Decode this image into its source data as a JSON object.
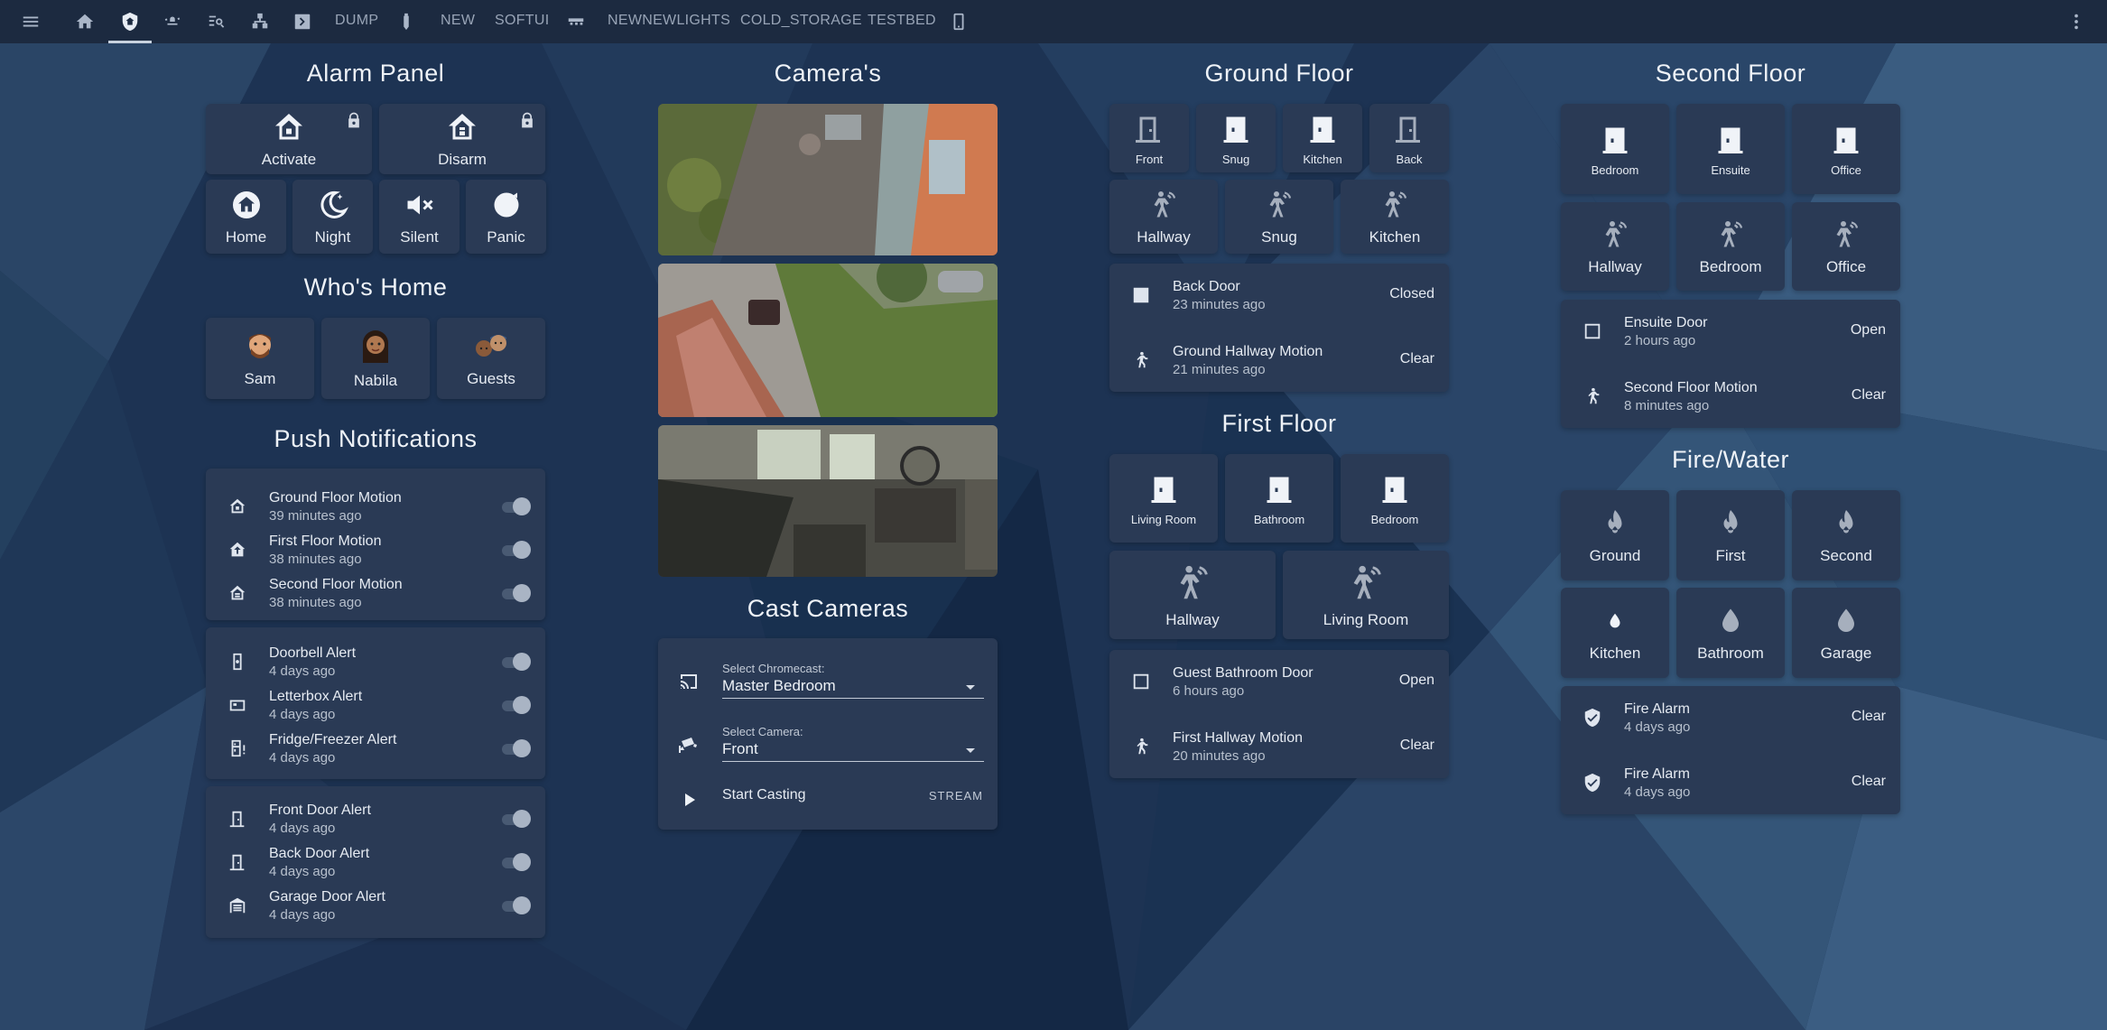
{
  "topbar": {
    "tabs_text": [
      "DUMP",
      "NEW",
      "SOFTUI",
      "NEWNEWLIGHTS",
      "COLD_STORAGE",
      "TESTBED"
    ],
    "icons": [
      "menu-icon",
      "home-icon",
      "shield-home-icon",
      "alert-icon",
      "search-list-icon",
      "network-icon",
      "chevron-box-icon",
      "usb-icon",
      "bed-icon",
      "phone-icon",
      "dots-vertical-icon"
    ]
  },
  "alarm": {
    "title": "Alarm Panel",
    "activate": "Activate",
    "disarm": "Disarm",
    "modes": [
      "Home",
      "Night",
      "Silent",
      "Panic"
    ]
  },
  "whos_home": {
    "title": "Who's Home",
    "people": [
      "Sam",
      "Nabila",
      "Guests"
    ]
  },
  "push": {
    "title": "Push Notifications",
    "groups": [
      [
        {
          "name": "Ground Floor Motion",
          "time": "39 minutes ago"
        },
        {
          "name": "First Floor Motion",
          "time": "38 minutes ago"
        },
        {
          "name": "Second Floor Motion",
          "time": "38 minutes ago"
        }
      ],
      [
        {
          "name": "Doorbell Alert",
          "time": "4 days ago"
        },
        {
          "name": "Letterbox Alert",
          "time": "4 days ago"
        },
        {
          "name": "Fridge/Freezer Alert",
          "time": "4 days ago"
        }
      ],
      [
        {
          "name": "Front Door Alert",
          "time": "4 days ago"
        },
        {
          "name": "Back Door Alert",
          "time": "4 days ago"
        },
        {
          "name": "Garage Door Alert",
          "time": "4 days ago"
        }
      ]
    ]
  },
  "cameras": {
    "title": "Camera's"
  },
  "cast": {
    "title": "Cast Cameras",
    "chromecast_label": "Select Chromecast:",
    "chromecast_value": "Master Bedroom",
    "camera_label": "Select Camera:",
    "camera_value": "Front",
    "start_label": "Start Casting",
    "stream_label": "STREAM"
  },
  "ground": {
    "title": "Ground Floor",
    "doors": [
      "Front",
      "Snug",
      "Kitchen",
      "Back"
    ],
    "motion": [
      "Hallway",
      "Snug",
      "Kitchen"
    ],
    "entities": [
      {
        "name": "Back Door",
        "time": "23 minutes ago",
        "state": "Closed"
      },
      {
        "name": "Ground Hallway Motion",
        "time": "21 minutes ago",
        "state": "Clear"
      }
    ]
  },
  "first": {
    "title": "First Floor",
    "doors": [
      "Living Room",
      "Bathroom",
      "Bedroom"
    ],
    "motion": [
      "Hallway",
      "Living Room"
    ],
    "entities": [
      {
        "name": "Guest Bathroom Door",
        "time": "6 hours ago",
        "state": "Open"
      },
      {
        "name": "First Hallway Motion",
        "time": "20 minutes ago",
        "state": "Clear"
      }
    ]
  },
  "second": {
    "title": "Second Floor",
    "doors": [
      "Bedroom",
      "Ensuite",
      "Office"
    ],
    "motion": [
      "Hallway",
      "Bedroom",
      "Office"
    ],
    "entities": [
      {
        "name": "Ensuite Door",
        "time": "2 hours ago",
        "state": "Open"
      },
      {
        "name": "Second Floor Motion",
        "time": "8 minutes ago",
        "state": "Clear"
      }
    ]
  },
  "firewater": {
    "title": "Fire/Water",
    "fire": [
      "Ground",
      "First",
      "Second"
    ],
    "water": [
      "Kitchen",
      "Bathroom",
      "Garage"
    ],
    "entities": [
      {
        "name": "Fire Alarm",
        "time": "4 days ago",
        "state": "Clear"
      },
      {
        "name": "Fire Alarm",
        "time": "4 days ago",
        "state": "Clear"
      }
    ]
  },
  "colors": {
    "background": "#1a3050",
    "card": "#2a3a55",
    "topbar": "#1c2a40",
    "text": "#e6ebf2"
  }
}
